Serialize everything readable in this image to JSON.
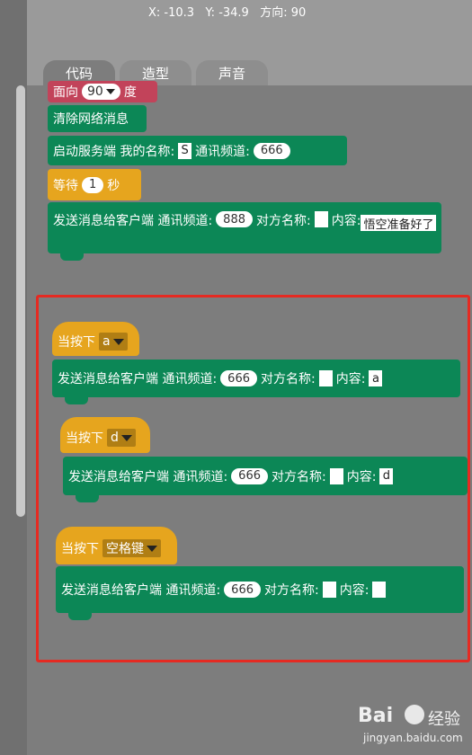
{
  "stage_coords": {
    "x": "X: -10.3",
    "y": "Y: -34.9",
    "dir": "方向: 90"
  },
  "tabs": [
    {
      "label": "代码"
    },
    {
      "label": "造型"
    },
    {
      "label": "声音"
    }
  ],
  "script1": {
    "face_block": {
      "label1": "面向",
      "value": "90",
      "label2": "度"
    },
    "clear_block": {
      "label": "清除网络消息"
    },
    "server_block": {
      "label1": "启动服务端 我的名称:",
      "name": "S",
      "label2": "通讯频道:",
      "channel": "666"
    },
    "wait_block": {
      "label1": "等待",
      "value": "1",
      "label2": "秒"
    },
    "send_block": {
      "label1": "发送消息给客户端 通讯频道:",
      "channel": "888",
      "label2": "对方名称:",
      "name": "",
      "label3": "内容:",
      "content": "悟空准备好了"
    }
  },
  "script_a": {
    "hat": {
      "label": "当按下",
      "key": "a"
    },
    "send": {
      "label1": "发送消息给客户端 通讯频道:",
      "channel": "666",
      "label2": "对方名称:",
      "name": "",
      "label3": "内容:",
      "content": "a"
    }
  },
  "script_d": {
    "hat": {
      "label": "当按下",
      "key": "d"
    },
    "send": {
      "label1": "发送消息给客户端 通讯频道:",
      "channel": "666",
      "label2": "对方名称:",
      "name": "",
      "label3": "内容:",
      "content": "d"
    }
  },
  "script_space": {
    "hat": {
      "label": "当按下",
      "key": "空格键"
    },
    "send": {
      "label1": "发送消息给客户端 通讯频道:",
      "channel": "666",
      "label2": "对方名称:",
      "name": "",
      "label3": "内容:",
      "content": ""
    }
  },
  "watermark": {
    "brand": "Bai",
    "word": "经验",
    "url": "jingyan.baidu.com"
  },
  "colors": {
    "event": "#e6a51e",
    "network": "#0c8756",
    "motion": "#c2435a",
    "highlight": "#e52a22"
  }
}
